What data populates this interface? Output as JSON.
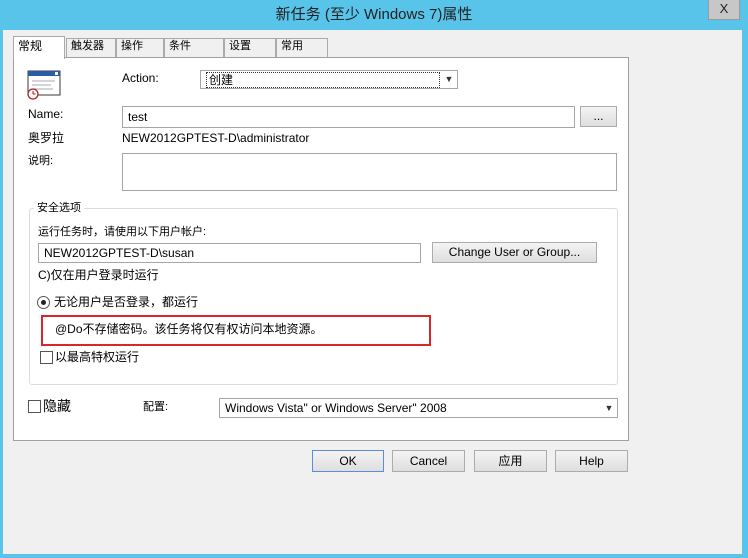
{
  "window": {
    "title": "新任务 (至少 Windows 7)属性",
    "close": "X"
  },
  "tabs": [
    {
      "label": "常规"
    },
    {
      "label": "触发器"
    },
    {
      "label": "操作"
    },
    {
      "label": "条件"
    },
    {
      "label": "设置"
    },
    {
      "label": "常用"
    }
  ],
  "general": {
    "action_label": "Action:",
    "action_value": "创建",
    "name_label": "Name:",
    "name_value": "test",
    "browse_label": "...",
    "author_label": "奥罗拉",
    "author_value": "NEW2012GPTEST-D\\administrator",
    "description_label": "说明:",
    "description_value": ""
  },
  "security": {
    "group_label": "安全选项",
    "run_as_label": "运行任务时，请使用以下用户帐户:",
    "user_value": "NEW2012GPTEST-D\\susan",
    "change_user_label": "Change User or Group...",
    "logged_on_only_label": "C)仅在用户登录时运行",
    "whether_logged_on_label": "无论用户是否登录，都运行",
    "whether_logged_on_selected": true,
    "no_store_password_label": "@Do不存储密码。该任务将仅有权访问本地资源。",
    "highest_privileges_label": "以最高特权运行",
    "highest_privileges_checked": false
  },
  "bottom": {
    "hidden_label": "隐藏",
    "hidden_checked": false,
    "configure_label": "配置:",
    "configure_value": "Windows Vista\" or Windows Server\" 2008"
  },
  "buttons": {
    "ok": "OK",
    "cancel": "Cancel",
    "apply": "应用",
    "help": "Help"
  },
  "colors": {
    "title_bar": "#59c4ea",
    "highlight_border": "#d9262a"
  }
}
